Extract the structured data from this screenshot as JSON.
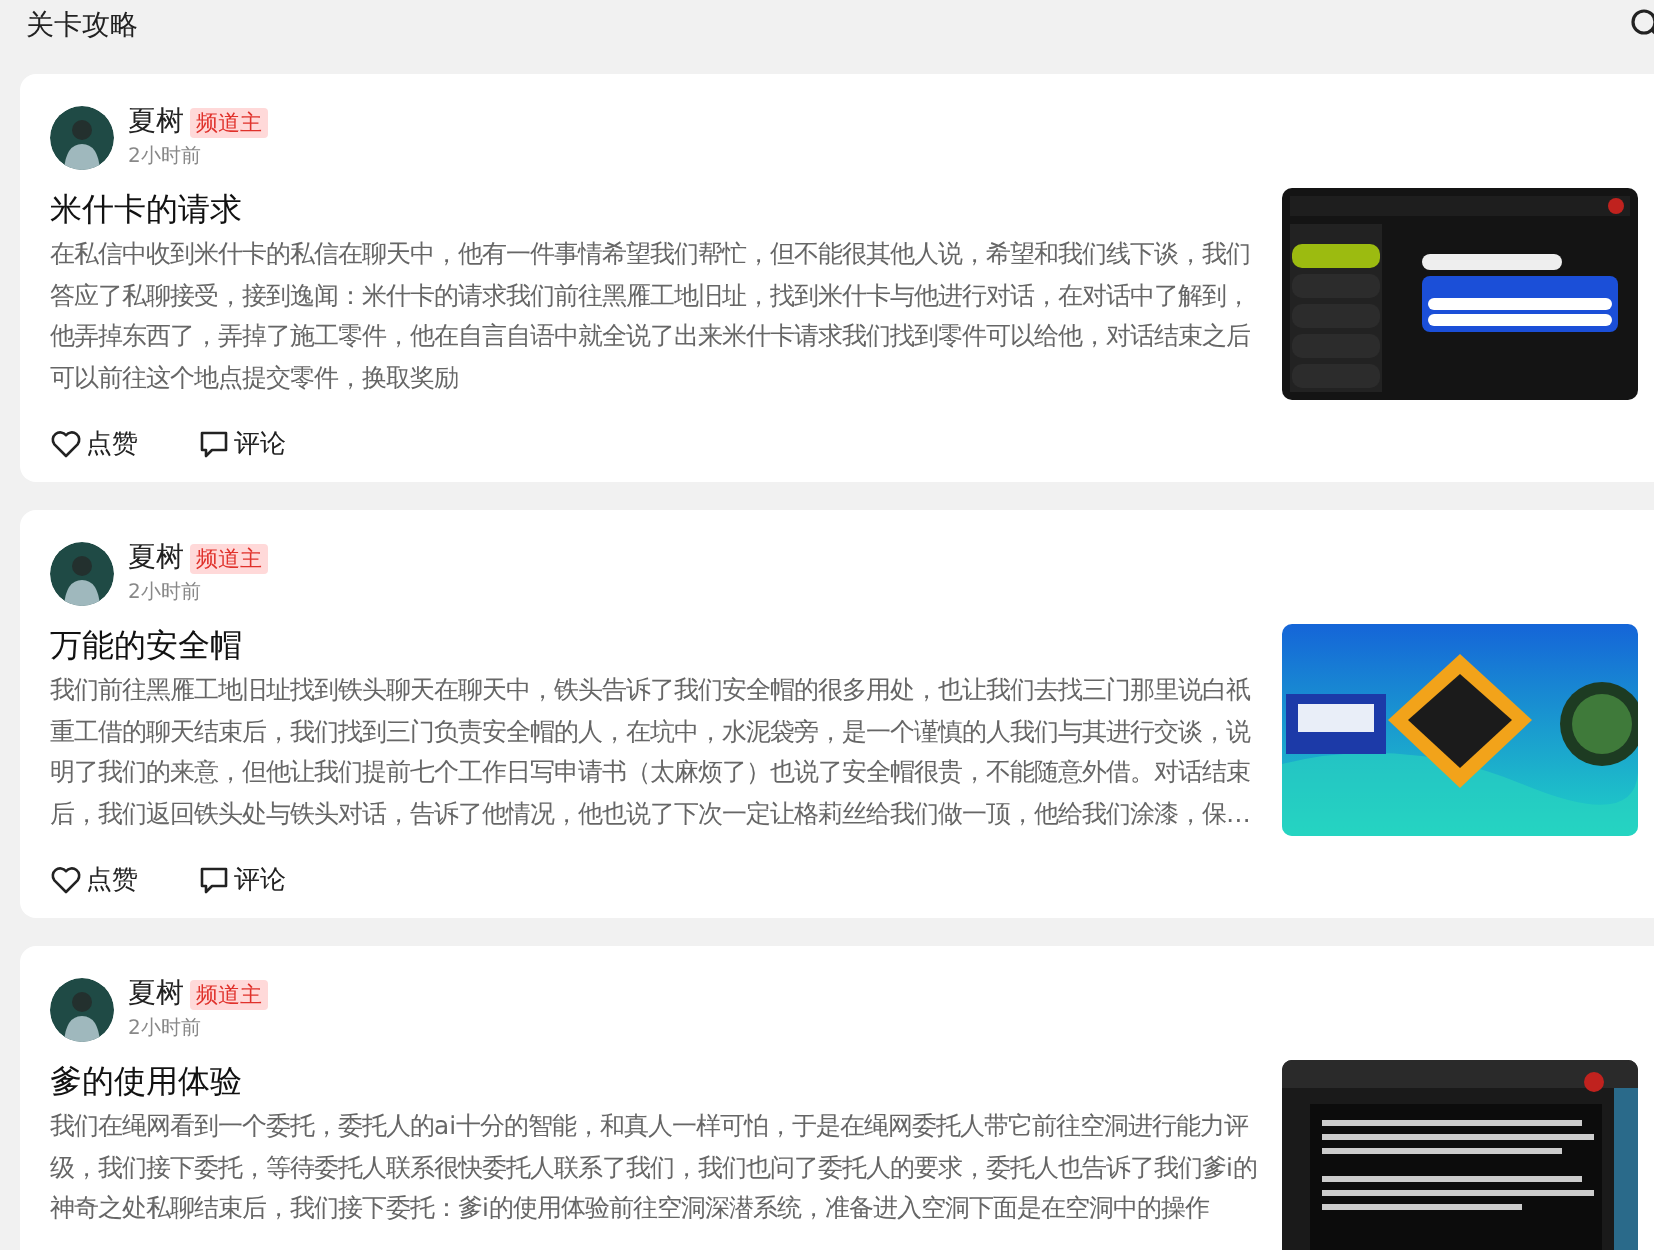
{
  "header": {
    "title": "关卡攻略"
  },
  "posts": [
    {
      "author": "夏树",
      "badge": "频道主",
      "time": "2小时前",
      "title": "米什卡的请求",
      "body": "在私信中收到米什卡的私信在聊天中，他有一件事情希望我们帮忙，但不能很其他人说，希望和我们线下谈，我们答应了私聊接受，接到逸闻：米什卡的请求我们前往黑雁工地旧址，找到米什卡与他进行对话，在对话中了解到，他弄掉东西了，弄掉了施工零件，他在自言自语中就全说了出来米什卡请求我们找到零件可以给他，对话结束之后可以前往这个地点提交零件，换取奖励",
      "like": "点赞",
      "comment": "评论"
    },
    {
      "author": "夏树",
      "badge": "频道主",
      "time": "2小时前",
      "title": "万能的安全帽",
      "body": "我们前往黑雁工地旧址找到铁头聊天在聊天中，铁头告诉了我们安全帽的很多用处，也让我们去找三门那里说白祇重工借的聊天结束后，我们找到三门负责安全帽的人，在坑中，水泥袋旁，是一个谨慎的人我们与其进行交谈，说明了我们的来意，但他让我们提前七个工作日写申请书（太麻烦了）也说了安全帽很贵，不能随意外借。对话结束后，我们返回铁头处与铁头对话，告诉了他情况，他也说了下次一定让格莉丝给我们做一顶，他给我们涂漆，保…",
      "like": "点赞",
      "comment": "评论"
    },
    {
      "author": "夏树",
      "badge": "频道主",
      "time": "2小时前",
      "title": "爹的使用体验",
      "body": "我们在绳网看到一个委托，委托人的ai十分的智能，和真人一样可怕，于是在绳网委托人带它前往空洞进行能力评级，我们接下委托，等待委托人联系很快委托人联系了我们，我们也问了委托人的要求，委托人也告诉了我们爹i的神奇之处私聊结束后，我们接下委托：爹i的使用体验前往空洞深潜系统，准备进入空洞下面是在空洞中的操作"
    }
  ]
}
